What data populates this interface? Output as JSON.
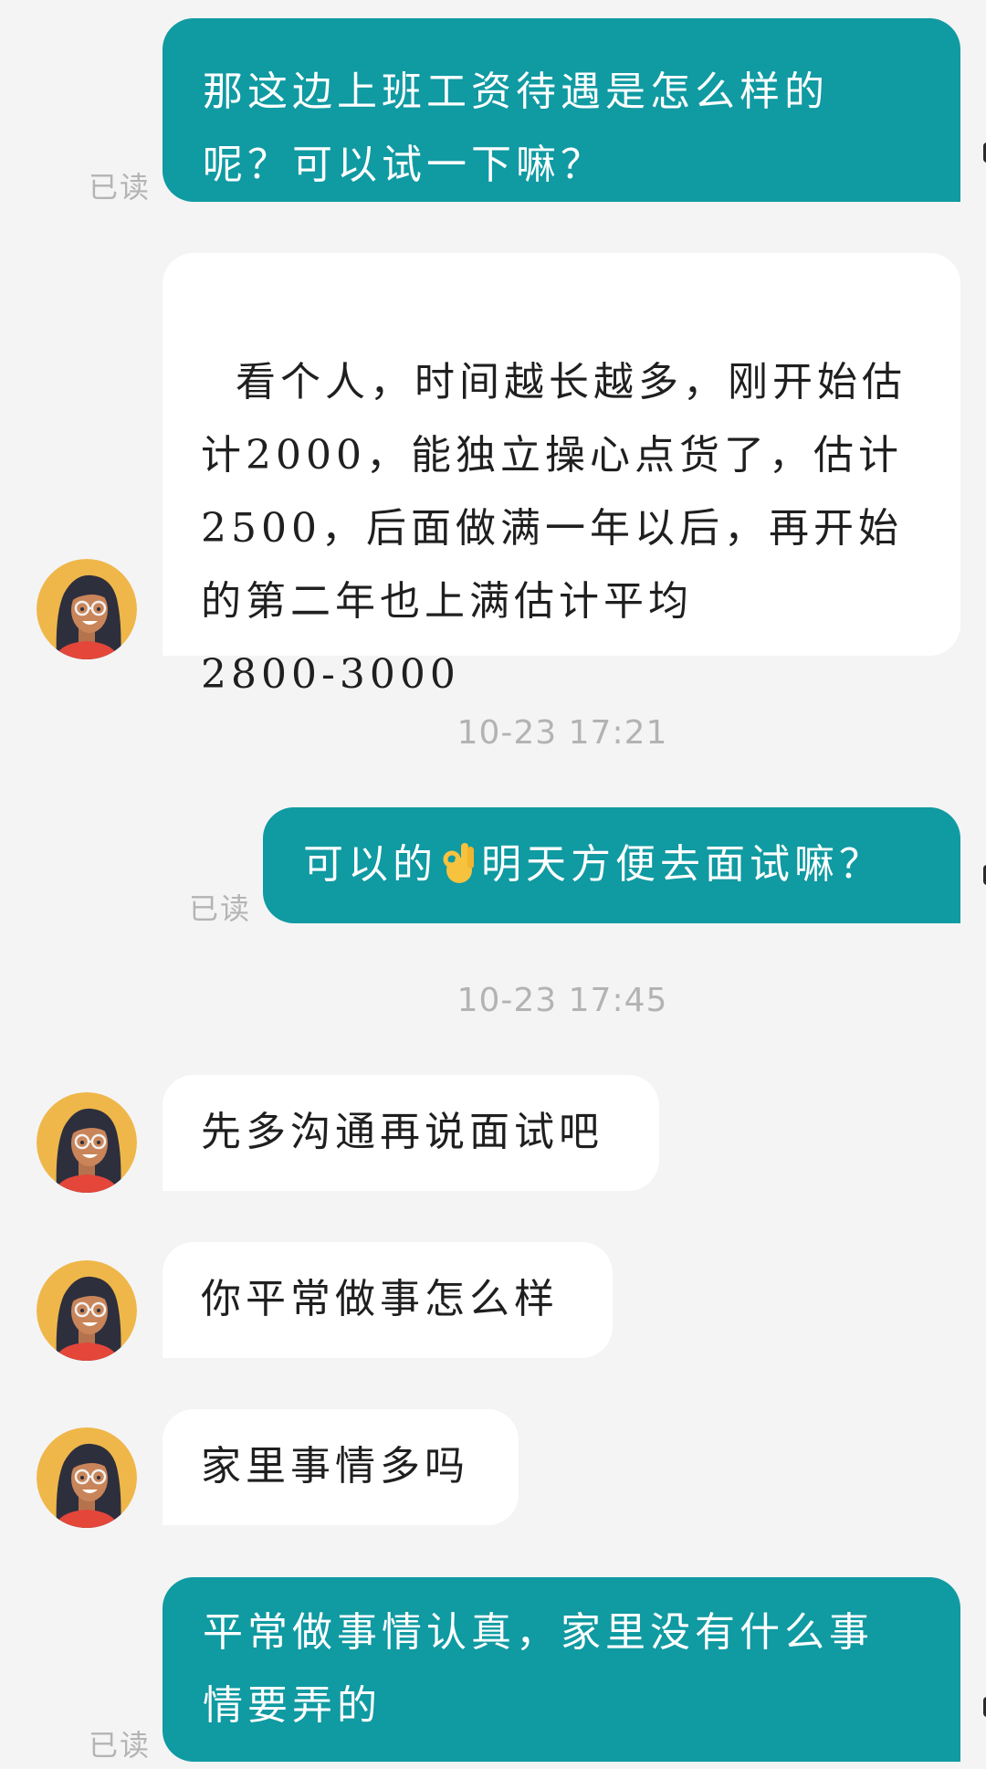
{
  "messages": [
    {
      "from": "me",
      "text": "那这边上班工资待遇是怎么样的呢？可以试一下嘛？",
      "status": "已读"
    },
    {
      "from": "them",
      "text": "看个人，时间越长越多，刚开始估计2000，能独立操心点货了，估计2500，后面做满一年以后，再开始的第二年也上满估计平均\n2800-3000"
    },
    {
      "timestamp": "10-23 17:21"
    },
    {
      "from": "me",
      "text_before": "可以的",
      "emoji": "ok-hand-emoji",
      "text_after": "明天方便去面试嘛？",
      "status": "已读"
    },
    {
      "timestamp": "10-23 17:45"
    },
    {
      "from": "them",
      "text": "先多沟通再说面试吧"
    },
    {
      "from": "them",
      "text": "你平常做事怎么样"
    },
    {
      "from": "them",
      "text": "家里事情多吗"
    },
    {
      "from": "me",
      "text": "平常做事情认真，家里没有什么事情要弄的",
      "status": "已读"
    }
  ],
  "colors": {
    "sent_bubble": "#109aa2",
    "received_bubble": "#ffffff",
    "background": "#f4f4f5",
    "timestamp_text": "#b3b3b3",
    "read_text": "#b4b4b4"
  }
}
